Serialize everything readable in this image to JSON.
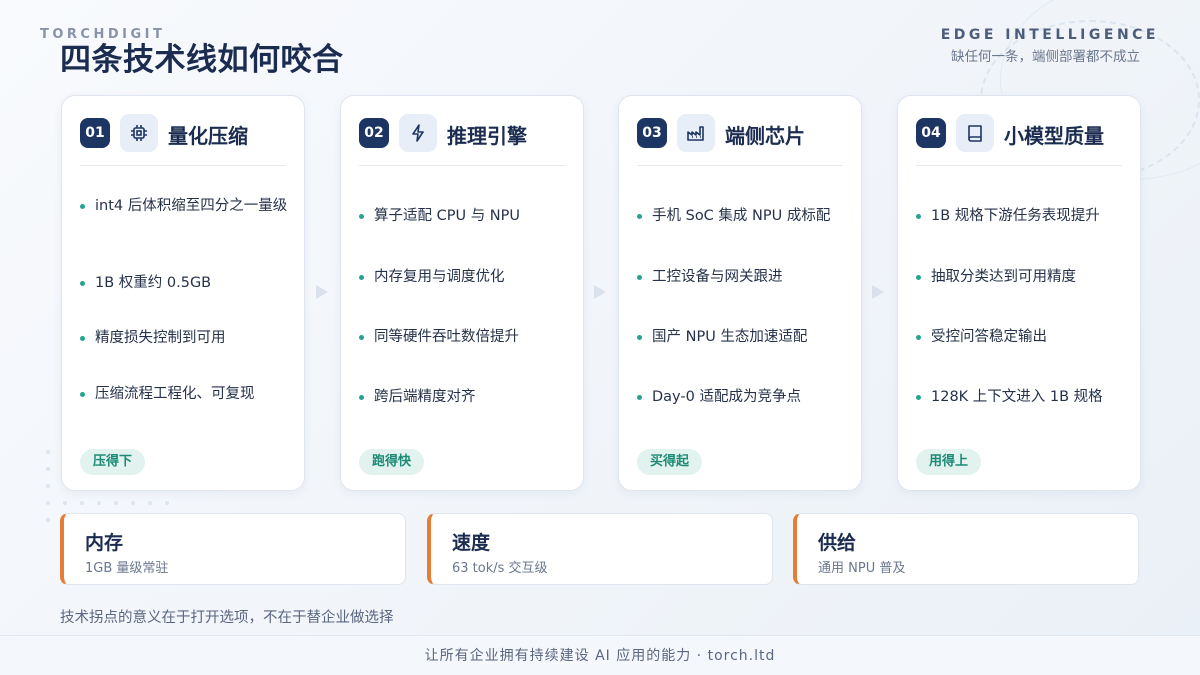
{
  "header": {
    "brand": "TORCHDIGIT",
    "title": "四条技术线如何咬合",
    "edge_label": "EDGE INTELLIGENCE",
    "edge_subtitle": "缺任何一条，端侧部署都不成立"
  },
  "cards": [
    {
      "num": "01",
      "icon": "chip-icon",
      "title": "量化压缩",
      "bullets": [
        "int4 后体积缩至四分之一量级",
        "1B 权重约 0.5GB",
        "精度损失控制到可用",
        "压缩流程工程化、可复现"
      ],
      "tag": "压得下"
    },
    {
      "num": "02",
      "icon": "lightning-icon",
      "title": "推理引擎",
      "bullets": [
        "算子适配 CPU 与 NPU",
        "内存复用与调度优化",
        "同等硬件吞吐数倍提升",
        "跨后端精度对齐"
      ],
      "tag": "跑得快"
    },
    {
      "num": "03",
      "icon": "factory-icon",
      "title": "端侧芯片",
      "bullets": [
        "手机 SoC 集成 NPU 成标配",
        "工控设备与网关跟进",
        "国产 NPU 生态加速适配",
        "Day-0 适配成为竞争点"
      ],
      "tag": "买得起"
    },
    {
      "num": "04",
      "icon": "book-icon",
      "title": "小模型质量",
      "bullets": [
        "1B 规格下游任务表现提升",
        "抽取分类达到可用精度",
        "受控问答稳定输出",
        "128K 上下文进入 1B 规格"
      ],
      "tag": "用得上"
    }
  ],
  "metrics": [
    {
      "title": "内存",
      "sub": "1GB 量级常驻"
    },
    {
      "title": "速度",
      "sub": "63 tok/s 交互级"
    },
    {
      "title": "供给",
      "sub": "通用 NPU 普及"
    }
  ],
  "note": "技术拐点的意义在于打开选项，不在于替企业做选择",
  "footer": "让所有企业拥有持续建设 AI 应用的能力 · torch.ltd",
  "colors": {
    "navy": "#1d3563",
    "teal": "#27a290",
    "orange": "#e47e37"
  }
}
